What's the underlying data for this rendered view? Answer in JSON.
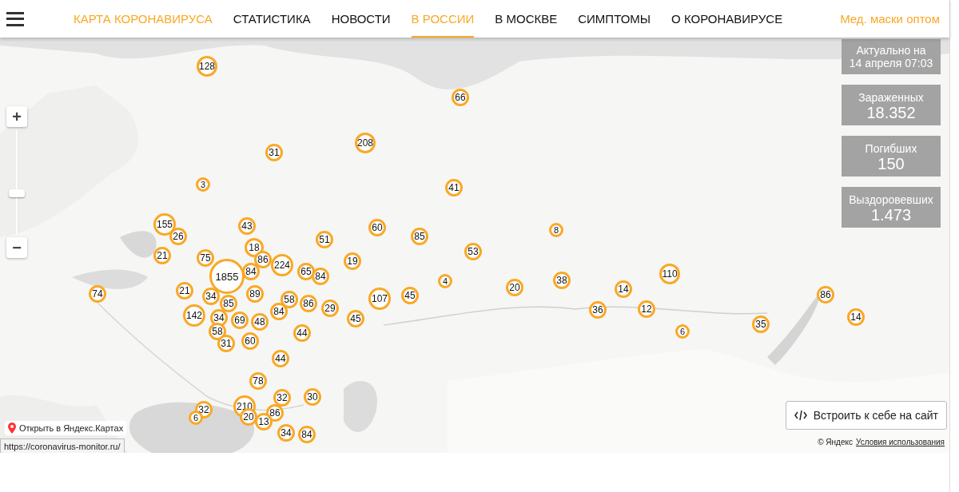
{
  "nav": {
    "items": [
      {
        "label": "КАРТА КОРОНАВИРУСА",
        "kind": "brand",
        "selected": false
      },
      {
        "label": "СТАТИСТИКА",
        "kind": "link",
        "selected": false
      },
      {
        "label": "НОВОСТИ",
        "kind": "link",
        "selected": false
      },
      {
        "label": "В РОССИИ",
        "kind": "link",
        "selected": true
      },
      {
        "label": "В МОСКВЕ",
        "kind": "link",
        "selected": false
      },
      {
        "label": "СИМПТОМЫ",
        "kind": "link",
        "selected": false
      },
      {
        "label": "О КОРОНАВИРУСЕ",
        "kind": "link",
        "selected": false
      }
    ],
    "promo": "Мед. маски оптом"
  },
  "map": {
    "zoom": {
      "in": "+",
      "out": "−",
      "level": 0.38
    },
    "markers": [
      {
        "count": "128"
      },
      {
        "count": "66"
      },
      {
        "count": "31"
      },
      {
        "count": "208"
      },
      {
        "count": "3"
      },
      {
        "count": "41"
      },
      {
        "count": "155"
      },
      {
        "count": "43"
      },
      {
        "count": "60"
      },
      {
        "count": "8"
      },
      {
        "count": "26"
      },
      {
        "count": "51"
      },
      {
        "count": "85"
      },
      {
        "count": "18"
      },
      {
        "count": "53"
      },
      {
        "count": "21"
      },
      {
        "count": "75"
      },
      {
        "count": "86"
      },
      {
        "count": "19"
      },
      {
        "count": "84"
      },
      {
        "count": "224"
      },
      {
        "count": "65"
      },
      {
        "count": "110"
      },
      {
        "count": "1855"
      },
      {
        "count": "84"
      },
      {
        "count": "4"
      },
      {
        "count": "38"
      },
      {
        "count": "21"
      },
      {
        "count": "89"
      },
      {
        "count": "20"
      },
      {
        "count": "14"
      },
      {
        "count": "74"
      },
      {
        "count": "34"
      },
      {
        "count": "58"
      },
      {
        "count": "107"
      },
      {
        "count": "45"
      },
      {
        "count": "86"
      },
      {
        "count": "85"
      },
      {
        "count": "86"
      },
      {
        "count": "29"
      },
      {
        "count": "36"
      },
      {
        "count": "12"
      },
      {
        "count": "142"
      },
      {
        "count": "34"
      },
      {
        "count": "84"
      },
      {
        "count": "45"
      },
      {
        "count": "14"
      },
      {
        "count": "69"
      },
      {
        "count": "48"
      },
      {
        "count": "35"
      },
      {
        "count": "58"
      },
      {
        "count": "44"
      },
      {
        "count": "6"
      },
      {
        "count": "31"
      },
      {
        "count": "60"
      },
      {
        "count": "44"
      },
      {
        "count": "78"
      },
      {
        "count": "32"
      },
      {
        "count": "30"
      },
      {
        "count": "32"
      },
      {
        "count": "210"
      },
      {
        "count": "86"
      },
      {
        "count": "6"
      },
      {
        "count": "20"
      },
      {
        "count": "13"
      },
      {
        "count": "34"
      },
      {
        "count": "84"
      }
    ],
    "stats": [
      {
        "label": "Актуально на",
        "value": "14 апреля 07:03",
        "kind": "date"
      },
      {
        "label": "Зараженных",
        "value": "18.352",
        "kind": "count"
      },
      {
        "label": "Погибших",
        "value": "150",
        "kind": "count"
      },
      {
        "label": "Выздоровевших",
        "value": "1.473",
        "kind": "count"
      }
    ],
    "open_link": "Открыть в Яндекс.Картах",
    "embed_button": "Встроить к себе на сайт",
    "copyright": "© Яндекс",
    "terms_link": "Условия использования"
  },
  "status_url": "https://coronavirus-monitor.ru/"
}
